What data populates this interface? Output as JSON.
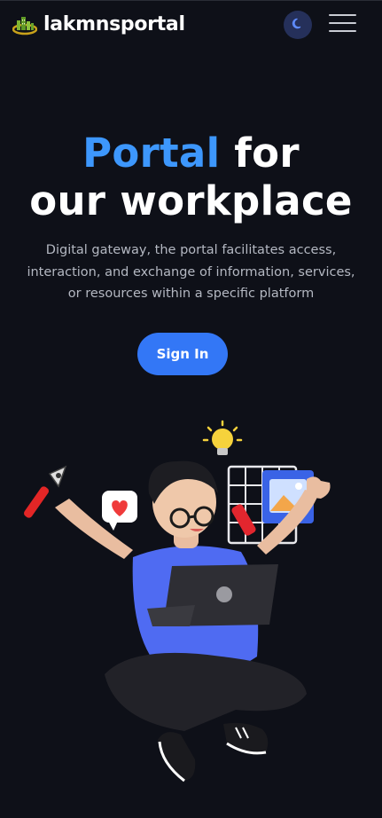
{
  "header": {
    "brand_name": "lakmnsportal",
    "logo_icon": "city-logo-icon",
    "theme_icon": "moon-icon",
    "menu_icon": "hamburger-menu-icon"
  },
  "hero": {
    "title_accent": "Portal",
    "title_rest": " for",
    "title_line2": "our workplace",
    "description": "Digital gateway, the portal facilitates access, interaction, and exchange of information, services, or resources within a specific platform",
    "cta_label": "Sign In"
  },
  "colors": {
    "background": "#0e1018",
    "accent": "#3d97fc",
    "button": "#3377f6",
    "text_muted": "#b4b8c2"
  }
}
